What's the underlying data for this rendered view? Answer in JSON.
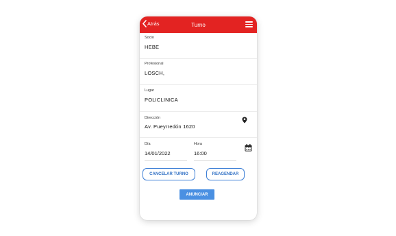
{
  "header": {
    "back_label": "Atrás",
    "title": "Turno"
  },
  "fields": {
    "socio": {
      "label": "Socio",
      "value": "HEBE"
    },
    "profesional": {
      "label": "Profesional",
      "value": "LOSCH,"
    },
    "lugar": {
      "label": "Lugar",
      "value": "POLICLINICA"
    },
    "direccion": {
      "label": "Dirección",
      "value": "Av. Pueyrredón 1620"
    },
    "dia": {
      "label": "Día",
      "value": "14/01/2022"
    },
    "hora": {
      "label": "Hora",
      "value": "16:00"
    }
  },
  "buttons": {
    "cancelar": "CANCELAR TURNO",
    "reagendar": "REAGENDAR",
    "anunciar": "ANUNCIAR"
  },
  "colors": {
    "header": "#e32322",
    "accent": "#4a90e2",
    "outline": "#3d7fd6"
  },
  "icons": {
    "back": "chevron-left-icon",
    "menu": "hamburger-menu-icon",
    "location": "map-pin-icon",
    "calendar": "calendar-icon"
  }
}
